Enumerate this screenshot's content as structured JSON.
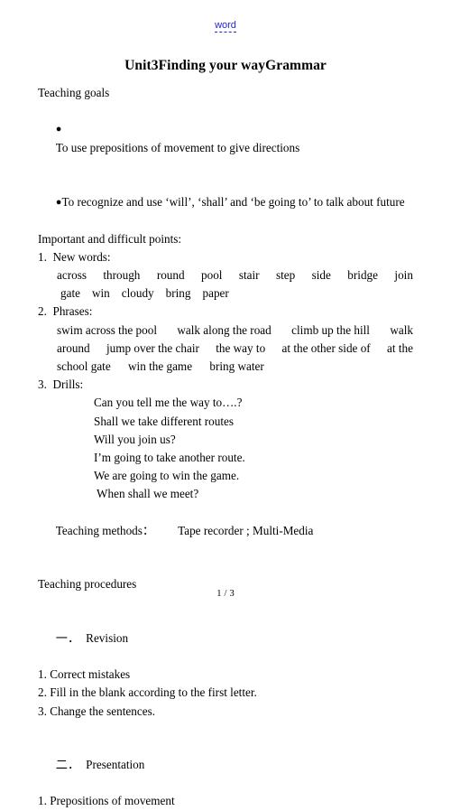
{
  "watermark": {
    "label": "word",
    "color": "#2323d8"
  },
  "title": "Unit3Finding your wayGrammar",
  "content": {
    "teaching_goals_heading": "Teaching goals",
    "goal_1": "To use prepositions of movement to give directions",
    "goal_2": "To recognize and use ‘will’, ‘shall’ and ‘be going to’ to talk about future",
    "important_points_heading": "Important and difficult points:",
    "item_1_label": "1.  New words:",
    "new_words_line_1": [
      "across",
      "through",
      "round",
      "pool",
      "stair",
      "step",
      "side",
      "bridge",
      "join"
    ],
    "new_words_line_2": [
      "gate",
      "win",
      "cloudy",
      "bring",
      "paper"
    ],
    "item_2_label": "2.  Phrases:",
    "phrases_line_1": [
      "swim across the pool",
      "walk along the road",
      "climb up the hill",
      "walk"
    ],
    "phrases_line_2": [
      "around",
      "jump over the chair",
      "the way to",
      "at the other side of",
      "at the"
    ],
    "phrases_line_3": [
      "school gate",
      "win the game",
      "bring water"
    ],
    "item_3_label": "3.  Drills:",
    "drills": [
      "Can you tell me the way to….?",
      "Shall we take different routes",
      "Will you join us?",
      "I’m going to take another route.",
      "We are going to win the game.",
      " When shall we meet?"
    ],
    "teaching_methods_label": "Teaching methods：",
    "teaching_methods_value": "Tape recorder ; Multi-Media",
    "teaching_procedures_heading": "Teaching procedures",
    "section_1_num": "一．",
    "section_1_title": "Revision",
    "section_1_items": [
      "1. Correct mistakes",
      "2. Fill in the blank according to the first letter.",
      "3. Change the sentences."
    ],
    "section_2_num": "二．",
    "section_2_title": "Presentation",
    "section_2_items": [
      "1. Prepositions of movement"
    ]
  },
  "footer": {
    "current_page": "1",
    "separator": "/",
    "total_pages": "3"
  }
}
